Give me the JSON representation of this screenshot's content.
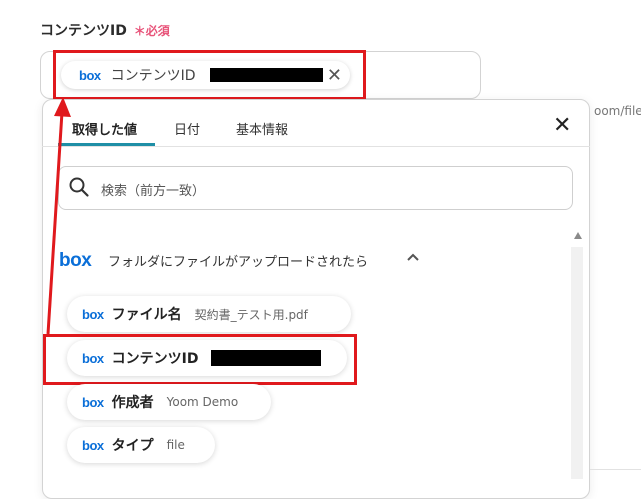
{
  "field": {
    "label": "コンテンツID",
    "required_mark": "＊",
    "required_text": "必須",
    "token_logo": "box",
    "token_label": "コンテンツID",
    "clear_icon": "✕"
  },
  "path_hint": "oom/files",
  "panel": {
    "tabs": [
      {
        "label": "取得した値",
        "active": true
      },
      {
        "label": "日付",
        "active": false
      },
      {
        "label": "基本情報",
        "active": false
      }
    ],
    "close_icon": "✕",
    "search_placeholder": "検索（前方一致）",
    "group": {
      "logo": "box",
      "title": "フォルダにファイルがアップロードされたら"
    },
    "items": [
      {
        "logo": "box",
        "name": "ファイル名",
        "value": "契約書_テスト用.pdf"
      },
      {
        "logo": "box",
        "name": "コンテンツID",
        "value": ""
      },
      {
        "logo": "box",
        "name": "作成者",
        "value": "Yoom Demo"
      },
      {
        "logo": "box",
        "name": "タイプ",
        "value": "file"
      }
    ]
  },
  "colors": {
    "highlight": "#e0191d",
    "accent_tab": "#1f8fa6",
    "required": "#e8547a",
    "box_blue": "#0b6fd8"
  }
}
